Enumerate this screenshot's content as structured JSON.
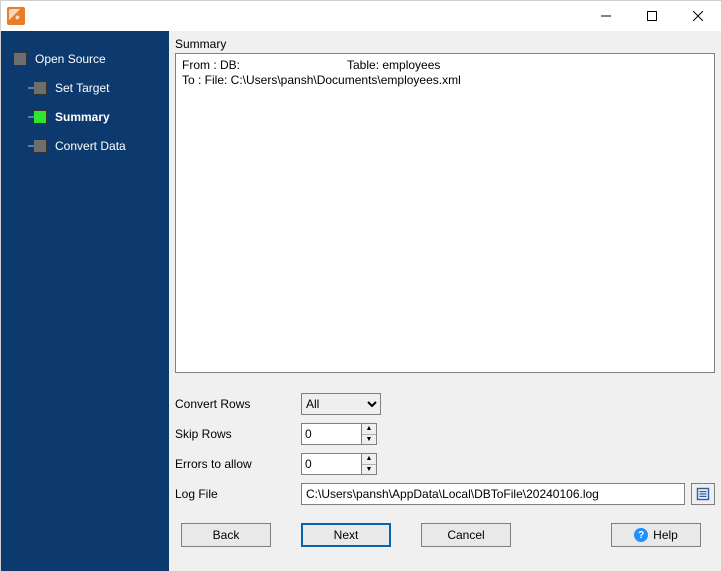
{
  "titlebar": {
    "title": ""
  },
  "sidebar": {
    "items": [
      {
        "label": "Open Source"
      },
      {
        "label": "Set Target"
      },
      {
        "label": "Summary"
      },
      {
        "label": "Convert Data"
      }
    ]
  },
  "summary": {
    "group_label": "Summary",
    "from_prefix": "From : DB:",
    "from_table": "Table: employees",
    "to_line": "To : File: C:\\Users\\pansh\\Documents\\employees.xml"
  },
  "controls": {
    "convert_rows_label": "Convert Rows",
    "convert_rows_value": "All",
    "skip_rows_label": "Skip Rows",
    "skip_rows_value": "0",
    "errors_label": "Errors to allow",
    "errors_value": "0",
    "log_label": "Log File",
    "log_value": "C:\\Users\\pansh\\AppData\\Local\\DBToFile\\20240106.log"
  },
  "footer": {
    "back": "Back",
    "next": "Next",
    "cancel": "Cancel",
    "help": "Help"
  }
}
